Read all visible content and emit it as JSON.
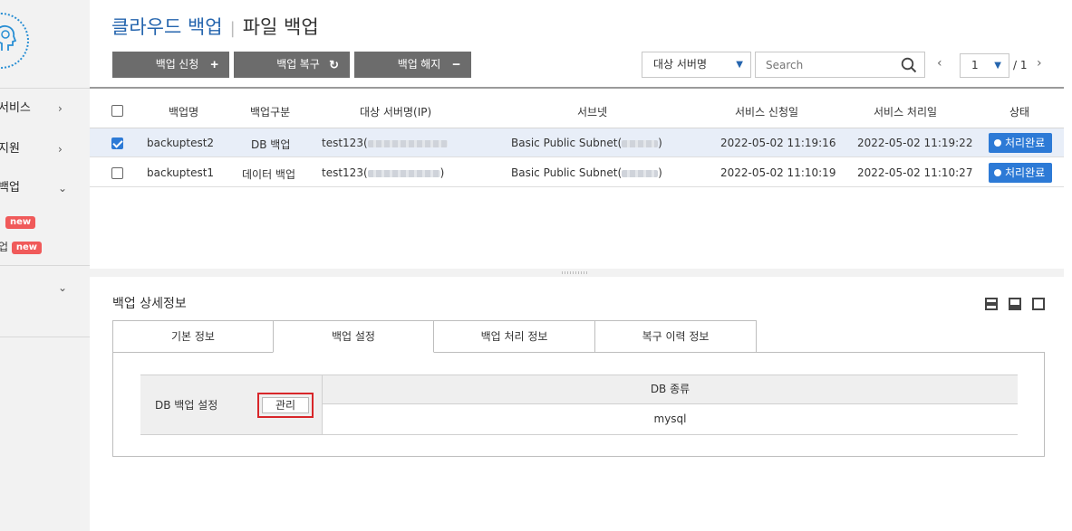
{
  "sidebar": {
    "items": [
      {
        "label": "서비스",
        "chevron": "›"
      },
      {
        "label": "지원",
        "chevron": "›"
      },
      {
        "label": "백업",
        "chevron": "⌄"
      }
    ],
    "sub_items": [
      {
        "label": "",
        "badge": "new"
      },
      {
        "label": "업",
        "badge": "new"
      }
    ],
    "extra_chevron": "⌄"
  },
  "header": {
    "title": "클라우드 백업",
    "separator": "|",
    "subtitle": "파일 백업"
  },
  "toolbar": {
    "apply_label": "백업 신청",
    "apply_icon": "+",
    "restore_label": "백업 복구",
    "restore_icon": "↻",
    "cancel_label": "백업 해지",
    "cancel_icon": "−",
    "filter_selected": "대상 서버명",
    "search_placeholder": "Search",
    "page_current": "1",
    "page_total": "/ 1",
    "prev": "‹",
    "next": "›"
  },
  "grid": {
    "columns": [
      "백업명",
      "백업구분",
      "대상 서버명(IP)",
      "서브넷",
      "서비스 신청일",
      "서비스 처리일",
      "상태"
    ],
    "rows": [
      {
        "checked": true,
        "name": "backuptest2",
        "type": "DB 백업",
        "server": "test123(",
        "subnet": "Basic Public Subnet(",
        "subnet_end": ")",
        "requested": "2022-05-02 11:19:16",
        "processed": "2022-05-02 11:19:22",
        "status": "처리완료"
      },
      {
        "checked": false,
        "name": "backuptest1",
        "type": "데이터 백업",
        "server": "test123(",
        "server_end": ")",
        "subnet": "Basic Public Subnet(",
        "subnet_end": ")",
        "requested": "2022-05-02 11:10:19",
        "processed": "2022-05-02 11:10:27",
        "status": "처리완료"
      }
    ]
  },
  "detail": {
    "title": "백업 상세정보",
    "tabs": [
      "기본 정보",
      "백업 설정",
      "백업 처리 정보",
      "복구 이력 정보"
    ],
    "active_tab": 1,
    "setting_label": "DB 백업 설정",
    "manage_label": "관리",
    "db_type_header": "DB 종류",
    "db_type_value": "mysql"
  },
  "colors": {
    "accent": "#2565ae",
    "status": "#2d7ad6",
    "badge": "#f05a5a",
    "highlight": "#d8262a"
  }
}
